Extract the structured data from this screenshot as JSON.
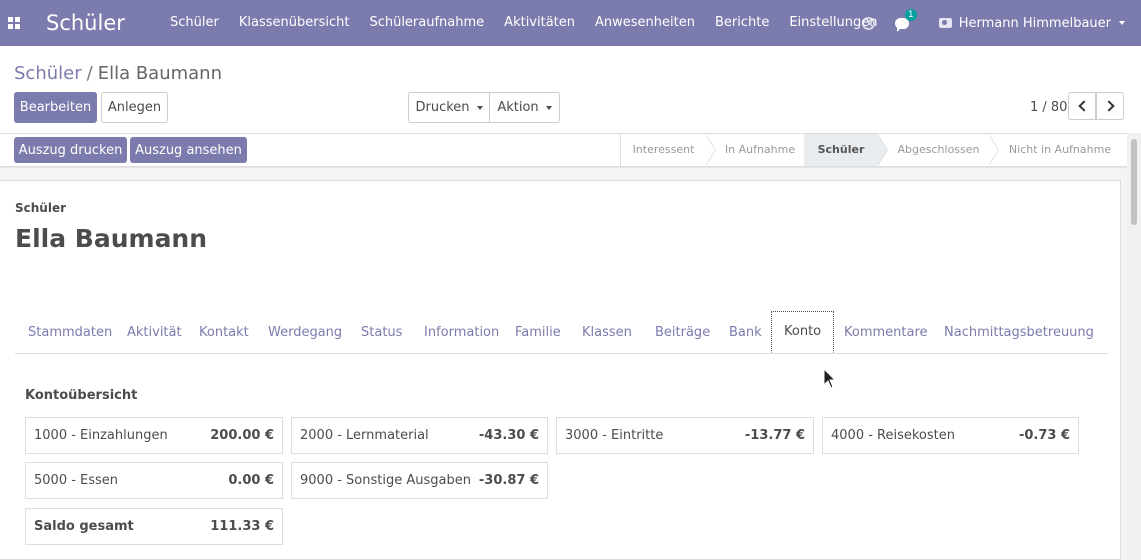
{
  "navbar": {
    "brand": "Schüler",
    "menu": [
      "Schüler",
      "Klassenübersicht",
      "Schüleraufnahme",
      "Aktivitäten",
      "Anwesenheiten",
      "Berichte",
      "Einstellungen"
    ],
    "chat_badge": "1",
    "user_name": "Hermann Himmelbauer",
    "colors": {
      "navbar_bg": "#7c7bad",
      "badge_bg": "#00a09d"
    }
  },
  "breadcrumb": {
    "parent": "Schüler",
    "separator": "/",
    "current": "Ella Baumann"
  },
  "buttons": {
    "edit": "Bearbeiten",
    "create": "Anlegen",
    "print": "Drucken",
    "action": "Aktion",
    "print_statement": "Auszug drucken",
    "view_statement": "Auszug ansehen"
  },
  "pager": {
    "value": "1 / 80"
  },
  "stages": [
    "Interessent",
    "In Aufnahme",
    "Schüler",
    "Abgeschlossen",
    "Nicht in Aufnahme"
  ],
  "active_stage": "Schüler",
  "record": {
    "label": "Schüler",
    "name": "Ella Baumann"
  },
  "tabs": [
    "Stammdaten",
    "Aktivität",
    "Kontakt",
    "Werdegang",
    "Status",
    "Information",
    "Familie",
    "Klassen",
    "Beiträge",
    "Bank",
    "Konto",
    "Kommentare",
    "Nachmittagsbetreuung"
  ],
  "active_tab": "Konto",
  "account": {
    "title": "Kontoübersicht",
    "items": [
      {
        "label": "1000 - Einzahlungen",
        "amount": "200.00 €"
      },
      {
        "label": "2000 - Lernmaterial",
        "amount": "-43.30 €"
      },
      {
        "label": "3000 - Eintritte",
        "amount": "-13.77 €"
      },
      {
        "label": "4000 - Reisekosten",
        "amount": "-0.73 €"
      },
      {
        "label": "5000 - Essen",
        "amount": "0.00 €"
      },
      {
        "label": "9000 - Sonstige Ausgaben",
        "amount": "-30.87 €"
      }
    ],
    "total": {
      "label": "Saldo gesamt",
      "amount": "111.33 €"
    }
  }
}
